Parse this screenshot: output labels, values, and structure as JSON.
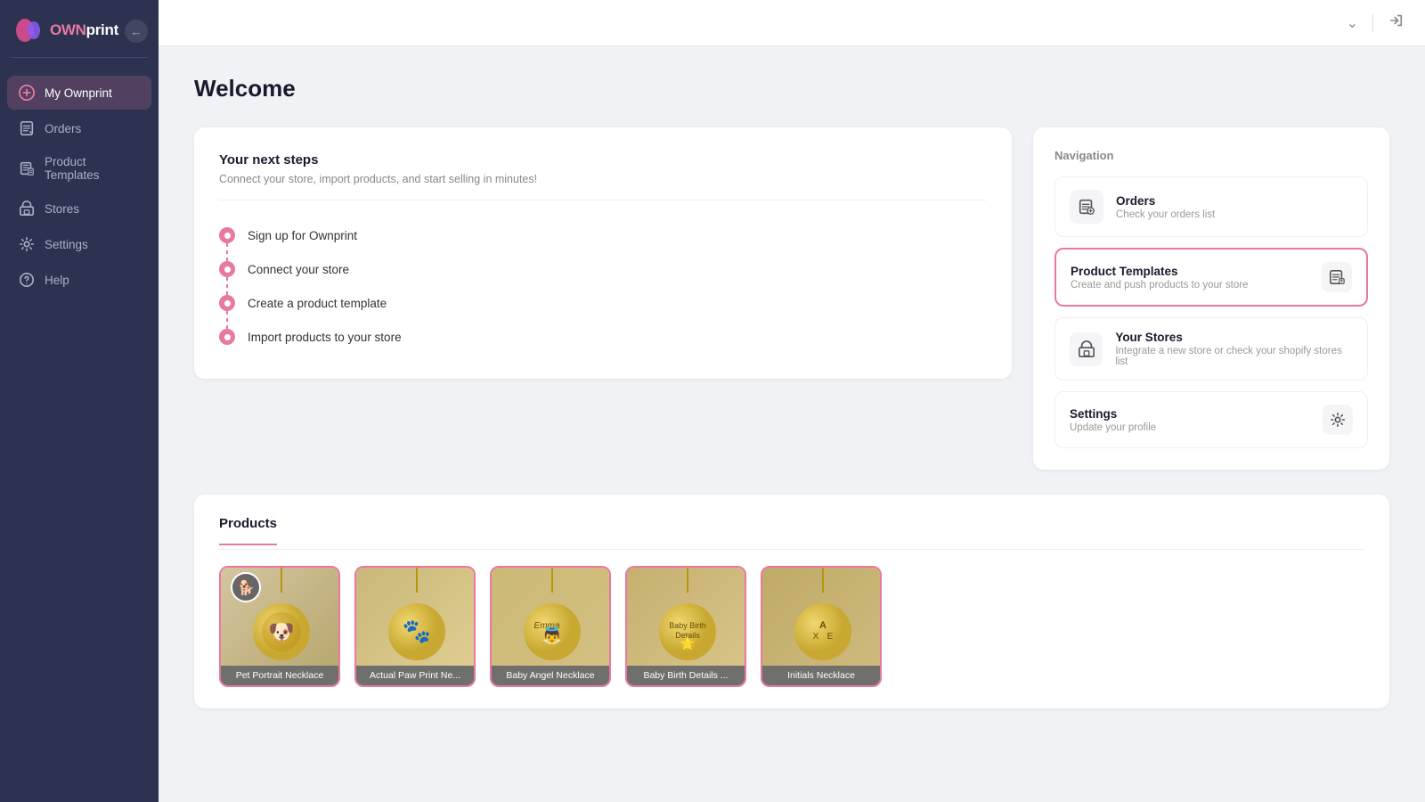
{
  "app": {
    "name": "OWNprint",
    "name_own": "OWN",
    "name_print": "print"
  },
  "sidebar": {
    "items": [
      {
        "id": "my-ownprint",
        "label": "My Ownprint",
        "icon": "circle-plus",
        "active": true
      },
      {
        "id": "orders",
        "label": "Orders",
        "icon": "receipt",
        "active": false
      },
      {
        "id": "product-templates",
        "label": "Product Templates",
        "icon": "layers",
        "active": false
      },
      {
        "id": "stores",
        "label": "Stores",
        "icon": "store",
        "active": false
      },
      {
        "id": "settings",
        "label": "Settings",
        "icon": "gear",
        "active": false
      },
      {
        "id": "help",
        "label": "Help",
        "icon": "question-circle",
        "active": false
      }
    ]
  },
  "header": {
    "title": "Welcome"
  },
  "next_steps": {
    "title": "Your next steps",
    "subtitle": "Connect your store, import products, and start selling in minutes!",
    "steps": [
      {
        "id": "step1",
        "label": "Sign up for Ownprint"
      },
      {
        "id": "step2",
        "label": "Connect your store"
      },
      {
        "id": "step3",
        "label": "Create a product template"
      },
      {
        "id": "step4",
        "label": "Import products to your store"
      }
    ]
  },
  "navigation_card": {
    "title": "Navigation",
    "items": [
      {
        "id": "orders",
        "name": "Orders",
        "desc": "Check your orders list",
        "icon": "≡+",
        "highlighted": false
      },
      {
        "id": "product-templates",
        "name": "Product Templates",
        "desc": "Create and push products to your store",
        "icon": "📋",
        "highlighted": true
      },
      {
        "id": "your-stores",
        "name": "Your Stores",
        "desc": "Integrate a new store or check your shopify stores list",
        "icon": "🏪",
        "highlighted": false
      },
      {
        "id": "settings",
        "name": "Settings",
        "desc": "Update your profile",
        "icon": "⚙",
        "highlighted": false
      }
    ]
  },
  "products": {
    "section_label": "Products",
    "items": [
      {
        "id": "pet-portrait",
        "label": "Pet Portrait Necklace",
        "emoji": "🐶"
      },
      {
        "id": "paw-print",
        "label": "Actual Paw Print Ne...",
        "emoji": "🐾"
      },
      {
        "id": "baby-angel",
        "label": "Baby Angel Necklace",
        "emoji": "👼"
      },
      {
        "id": "baby-birth",
        "label": "Baby Birth Details ...",
        "emoji": "🌟"
      },
      {
        "id": "initials",
        "label": "Initials Necklace",
        "emoji": "✦"
      }
    ]
  }
}
